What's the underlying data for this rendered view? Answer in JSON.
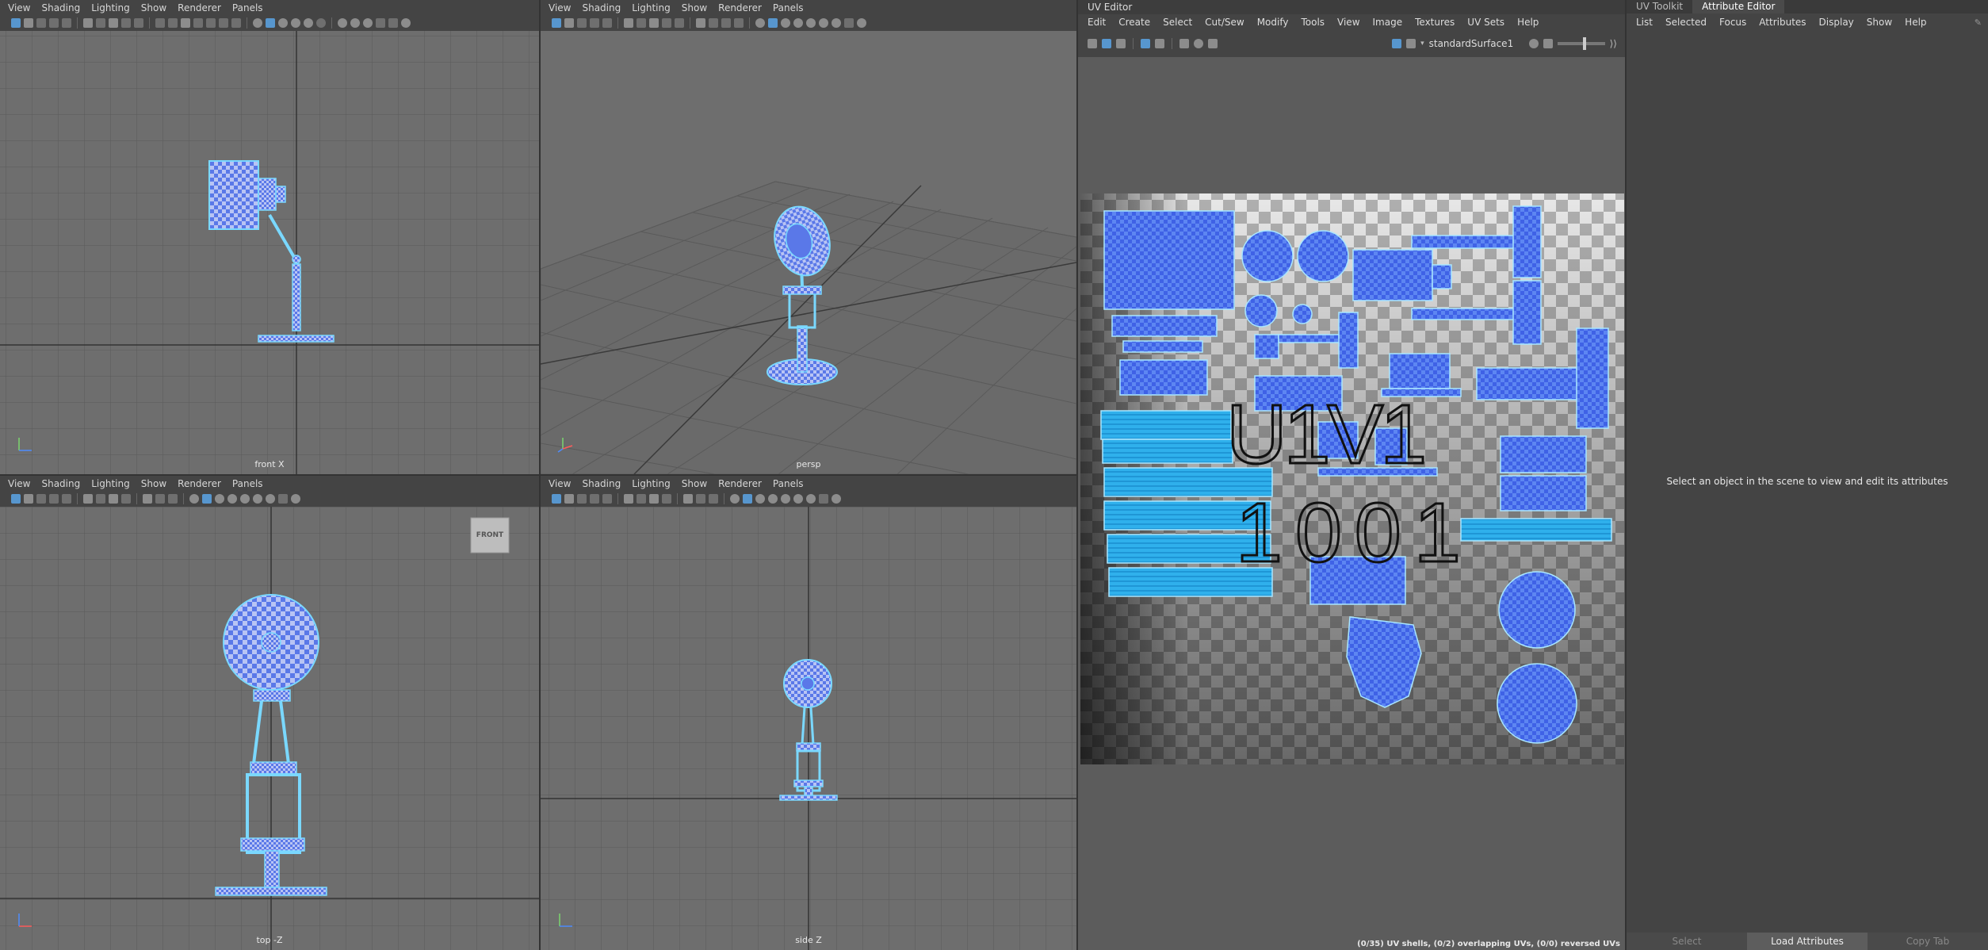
{
  "viewport_menu": [
    "View",
    "Shading",
    "Lighting",
    "Show",
    "Renderer",
    "Panels"
  ],
  "viewports": {
    "front": {
      "label": "front X"
    },
    "persp": {
      "label": "persp"
    },
    "top": {
      "label": "top -Z",
      "cube_label": "FRONT"
    },
    "side": {
      "label": "side Z"
    }
  },
  "uv_editor": {
    "title": "UV Editor",
    "menu": [
      "Edit",
      "Create",
      "Select",
      "Cut/Sew",
      "Modify",
      "Tools",
      "View",
      "Image",
      "Textures",
      "UV Sets",
      "Help"
    ],
    "material": "standardSurface1",
    "tile_label_top": "U1V1",
    "tile_label_bottom": "1001",
    "status": "(0/35) UV shells, (0/2) overlapping UVs, (0/0) reversed UVs"
  },
  "attribute_editor": {
    "tabs": [
      "UV Toolkit",
      "Attribute Editor"
    ],
    "menu": [
      "List",
      "Selected",
      "Focus",
      "Attributes",
      "Display",
      "Show",
      "Help"
    ],
    "message": "Select an object in the scene to view and edit its attributes",
    "buttons": [
      "Select",
      "Load Attributes",
      "Copy Tab"
    ]
  },
  "colors": {
    "uv_shell": "#4a72f0",
    "uv_shell_alt": "#27a8e8",
    "wire": "#7ad8ff"
  }
}
